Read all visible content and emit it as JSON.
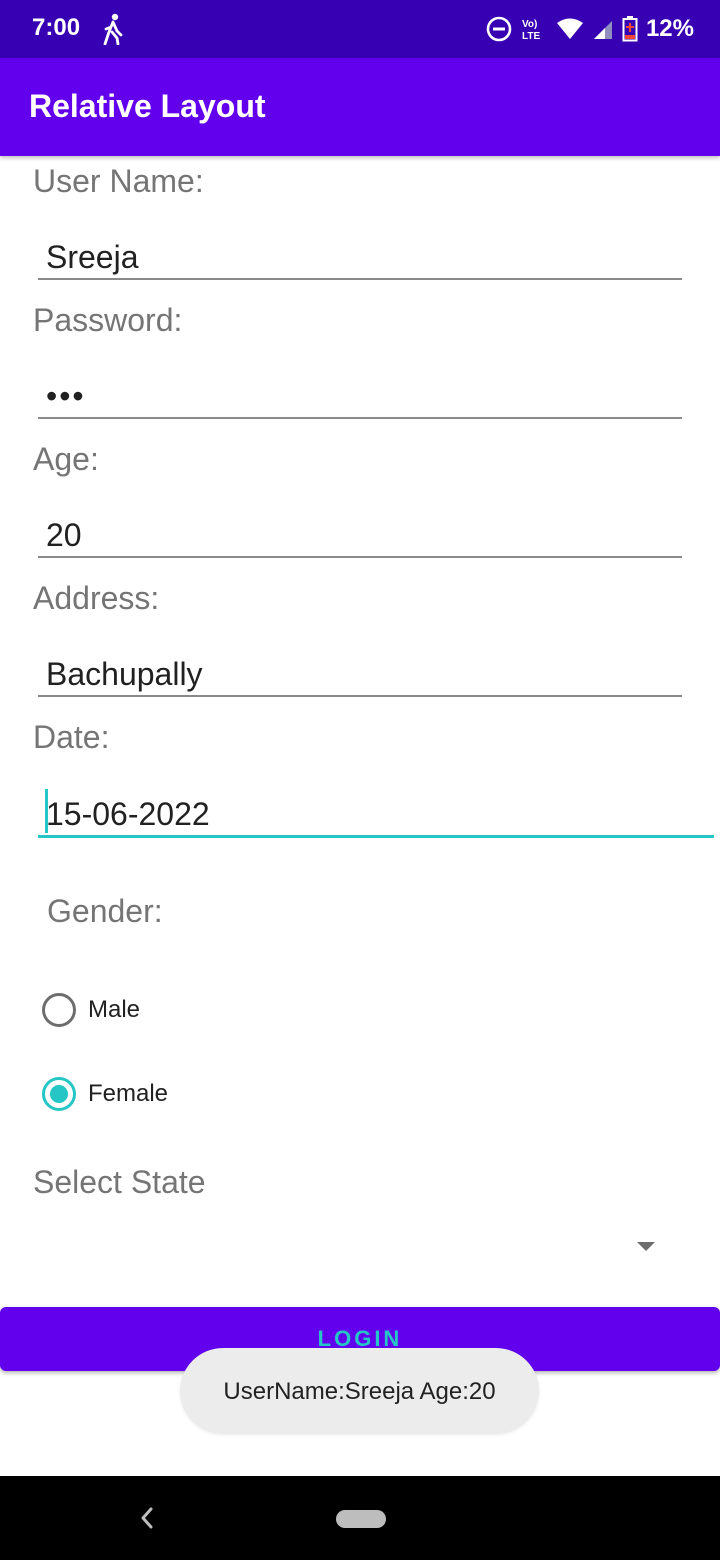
{
  "status_bar": {
    "time": "7:00",
    "battery": "12%",
    "icons": [
      "walking-icon",
      "do-not-disturb-icon",
      "volte-icon",
      "wifi-icon",
      "signal-icon",
      "battery-icon"
    ]
  },
  "app_bar": {
    "title": "Relative Layout",
    "color": "#6200ee"
  },
  "form": {
    "username_label": "User Name:",
    "username_value": "Sreeja",
    "password_label": "Password:",
    "password_value": "•••",
    "age_label": "Age:",
    "age_value": "20",
    "address_label": "Address:",
    "address_value": "Bachupally",
    "date_label": "Date:",
    "date_value": "15-06-2022",
    "gender_label": "Gender:",
    "gender_options": [
      "Male",
      "Female"
    ],
    "gender_selected": "Female",
    "state_label": "Select State"
  },
  "login_button": {
    "label": "LOGIN"
  },
  "toast": {
    "message": "UserName:Sreeja Age:20"
  },
  "colors": {
    "primary": "#6200ee",
    "primary_dark": "#3700b3",
    "accent": "#26c6c6"
  }
}
